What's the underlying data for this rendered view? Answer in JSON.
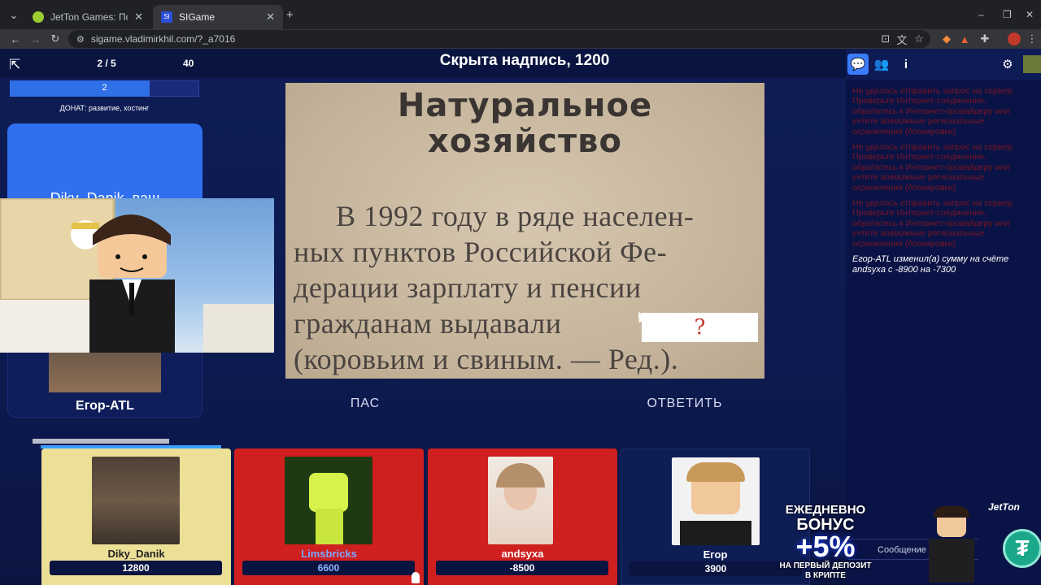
{
  "browser": {
    "tabs": [
      {
        "title": "JetTon Games: Погружение в м",
        "active": false,
        "favicon_color": "#9acd32"
      },
      {
        "title": "SIGame",
        "active": true,
        "favicon_color": "#2a4fd6",
        "favicon_text": "SI"
      }
    ],
    "new_tab": "+",
    "url": "sigame.vladimirkhil.com/?_a7016",
    "window_controls": {
      "minimize": "–",
      "restore": "❐",
      "close": "✕"
    }
  },
  "game": {
    "round_title": "Скрыта надпись, 1200",
    "counter": "2 / 5",
    "timer_value": "40",
    "progress_label": "2",
    "progress_fraction": 0.74,
    "donate_text": "ДОНАТ: развитие, хостинг",
    "showman_text": "Diky_Danik, ваш",
    "showman_name": "Егор-ATL",
    "question": {
      "heading_line1": "Натуральное",
      "heading_line2": "хозяйство",
      "lines": [
        "В 1992 году в ряде населен-",
        "ных пунктов Российской Фе-",
        "дерации зарплату и пенсии",
        "гражданам выдавали",
        "(коровьим и свиным. — Ред.)."
      ],
      "hidden_mark": "?"
    },
    "buttons": {
      "pass": "ПАС",
      "answer": "ОТВЕТИТЬ"
    },
    "players": [
      {
        "name": "Diky_Danik",
        "score": "12800",
        "theme": "yellow"
      },
      {
        "name": "Limsbricks",
        "score": "6600",
        "theme": "red"
      },
      {
        "name": "andsyxa",
        "score": "-8500",
        "theme": "red"
      },
      {
        "name": "Егор",
        "score": "3900",
        "theme": "dark"
      }
    ]
  },
  "sidebar": {
    "icons": [
      "chat-icon",
      "people-icon",
      "info-icon",
      "settings-icon"
    ],
    "error_messages": [
      "Не удалось отправить запрос на сервер. Проверьте Интернет-соединение, обратитесь к Интернет-провайдеру или учтите возможные региональные ограничения (блокировки)",
      "Не удалось отправить запрос на сервер. Проверьте Интернет-соединение, обратитесь к Интернет-провайдеру или учтите возможные региональные ограничения (блокировки)",
      "Не удалось отправить запрос на сервер. Проверьте Интернет-соединение, обратитесь к Интернет-провайдеру или учтите возможные региональные ограничения (блокировки)"
    ],
    "log_message": "Егор-ATL изменил(а) сумму на счёте andsyxa с -8900 на -7300",
    "message_placeholder": "Сообщение"
  },
  "ad": {
    "line1": "ЕЖЕДНЕВНО",
    "line2": "БОНУС",
    "line3": "+5%",
    "line4": "НА ПЕРВЫЙ ДЕПОЗИТ",
    "line5": "В КРИПТЕ",
    "brand": "JetTon"
  }
}
